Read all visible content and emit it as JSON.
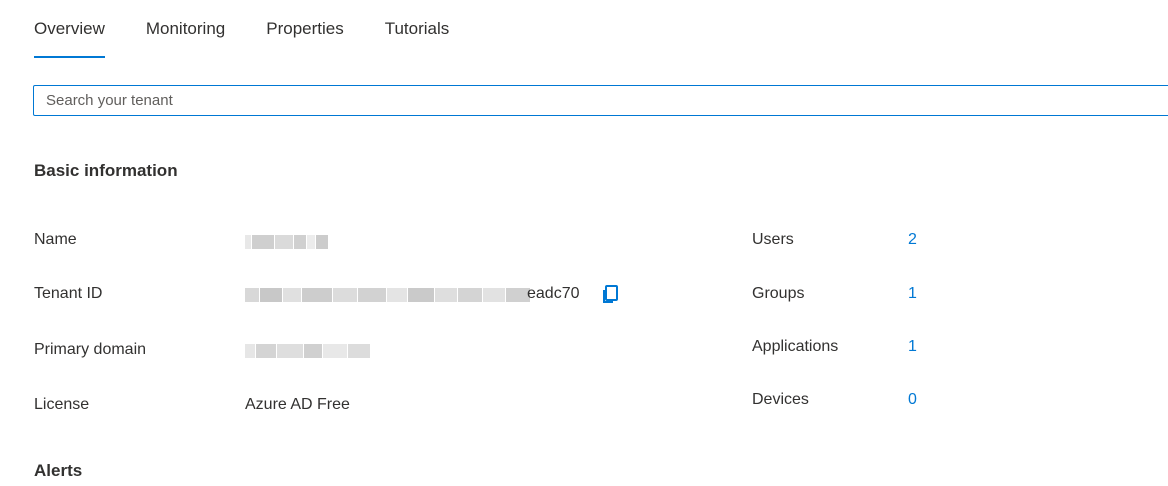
{
  "tabs": [
    {
      "label": "Overview",
      "active": true
    },
    {
      "label": "Monitoring",
      "active": false
    },
    {
      "label": "Properties",
      "active": false
    },
    {
      "label": "Tutorials",
      "active": false
    }
  ],
  "search": {
    "placeholder": "Search your tenant",
    "value": ""
  },
  "basic_info": {
    "title": "Basic information",
    "name": {
      "label": "Name",
      "value": ""
    },
    "tenant_id": {
      "label": "Tenant ID",
      "value_suffix": "eadc70"
    },
    "primary_domain": {
      "label": "Primary domain",
      "value": ""
    },
    "license": {
      "label": "License",
      "value": "Azure AD Free"
    }
  },
  "stats": {
    "users": {
      "label": "Users",
      "value": "2"
    },
    "groups": {
      "label": "Groups",
      "value": "1"
    },
    "applications": {
      "label": "Applications",
      "value": "1"
    },
    "devices": {
      "label": "Devices",
      "value": "0"
    }
  },
  "alerts": {
    "title": "Alerts"
  },
  "colors": {
    "accent": "#0078d4",
    "text": "#323130",
    "redacted": "#d2d2d2"
  },
  "icons": {
    "copy": "copy-icon"
  }
}
